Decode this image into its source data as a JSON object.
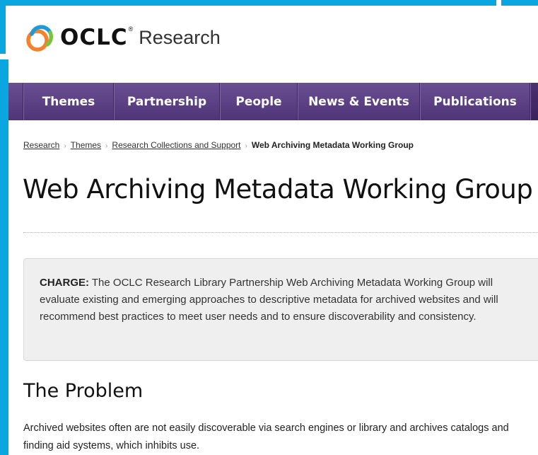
{
  "brand": {
    "name": "OCLC",
    "registered": "®",
    "sub": "Research",
    "colors": {
      "orange": "#f5822a",
      "blue": "#1f9ad6",
      "green": "#7cc242",
      "nav": "#5a3f82",
      "frame": "#0aa6e0"
    },
    "icon": "oclc-swirl-icon"
  },
  "nav": {
    "items": [
      {
        "label": "Themes"
      },
      {
        "label": "Partnership"
      },
      {
        "label": "People"
      },
      {
        "label": "News & Events"
      },
      {
        "label": "Publications"
      }
    ]
  },
  "breadcrumb": {
    "items": [
      {
        "label": "Research"
      },
      {
        "label": "Themes"
      },
      {
        "label": "Research Collections and Support"
      }
    ],
    "current": "Web Archiving Metadata Working Group"
  },
  "page": {
    "title": "Web Archiving Metadata Working Group"
  },
  "charge": {
    "label": "CHARGE:",
    "text": " The OCLC Research Library Partnership Web Archiving Metadata Working Group will evaluate existing and emerging approaches to descriptive metadata for archived websites and will recommend best practices to meet user needs and to ensure discoverability and consistency."
  },
  "problem": {
    "heading": "The Problem",
    "body": "Archived websites often are not easily discoverable via search engines or library and archives catalogs and finding aid systems, which inhibits use."
  }
}
